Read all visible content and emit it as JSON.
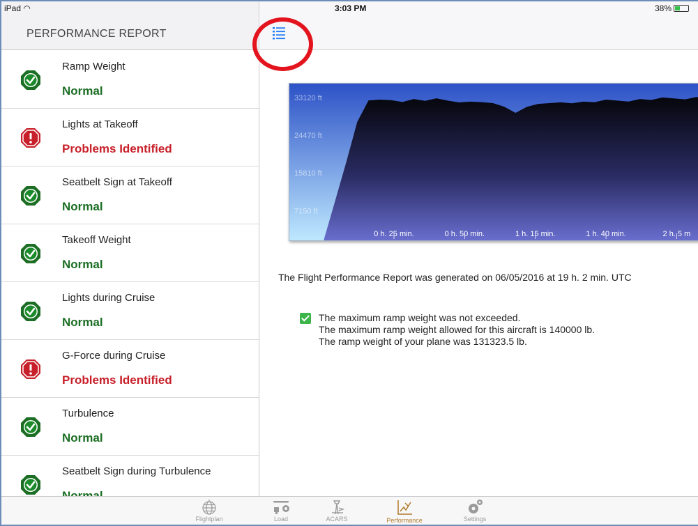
{
  "status_bar": {
    "carrier": "iPad",
    "time": "3:03 PM",
    "battery": "38%"
  },
  "sidebar": {
    "title": "PERFORMANCE REPORT",
    "items": [
      {
        "label": "Ramp Weight",
        "status": "Normal",
        "state": "ok"
      },
      {
        "label": "Lights at Takeoff",
        "status": "Problems Identified",
        "state": "bad"
      },
      {
        "label": "Seatbelt Sign at Takeoff",
        "status": "Normal",
        "state": "ok"
      },
      {
        "label": "Takeoff Weight",
        "status": "Normal",
        "state": "ok"
      },
      {
        "label": "Lights during Cruise",
        "status": "Normal",
        "state": "ok"
      },
      {
        "label": "G-Force during Cruise",
        "status": "Problems Identified",
        "state": "bad"
      },
      {
        "label": "Turbulence",
        "status": "Normal",
        "state": "ok"
      },
      {
        "label": "Seatbelt Sign during Turbulence",
        "status": "Normal",
        "state": "ok"
      }
    ]
  },
  "main": {
    "generated_text": "The Flight Performance Report was generated on 06/05/2016 at 19 h. 2 min. UTC",
    "weight_lines": [
      "The maximum ramp weight was not exceeded.",
      "The maximum ramp weight allowed for this aircraft is 140000 lb.",
      "The ramp weight of your plane was 131323.5 lb."
    ]
  },
  "chart_data": {
    "type": "area",
    "y_tick_labels": [
      "33120 ft",
      "24470 ft",
      "15810 ft",
      "7150 ft"
    ],
    "y_ticks": [
      33120,
      24470,
      15810,
      7150
    ],
    "x_tick_labels": [
      "0 h. 25 min.",
      "0 h. 50 min.",
      "1 h. 15 min.",
      "1 h. 40 min.",
      "2 h. 5 m"
    ],
    "x_ticks": [
      25,
      50,
      75,
      100,
      125
    ],
    "x": [
      0,
      4,
      8,
      12,
      16,
      20,
      24,
      28,
      32,
      36,
      40,
      44,
      48,
      52,
      56,
      60,
      64,
      68,
      72,
      76,
      80,
      84,
      88,
      92,
      96,
      100,
      104,
      108,
      112,
      116,
      120,
      124,
      128,
      132,
      136
    ],
    "altitude_ft": [
      0,
      9000,
      18000,
      27500,
      32600,
      32300,
      32500,
      32400,
      32600,
      32500,
      32600,
      32400,
      32300,
      32000,
      32200,
      31500,
      31000,
      29900,
      30800,
      31800,
      31500,
      32000,
      32100,
      32000,
      32200,
      32300,
      32400,
      32500,
      32600,
      32700,
      32800,
      32900,
      33000,
      33050,
      33100
    ],
    "xlim": [
      -12,
      136
    ],
    "ylim": [
      0,
      36300
    ],
    "colors": {
      "top": "#06060c",
      "bottom": "#6a6fd0",
      "sky_top": "#2d52c7",
      "sky_bottom": "#bfe9ff"
    }
  },
  "tabbar": {
    "tabs": [
      {
        "label": "Flightplan",
        "icon": "globe-icon"
      },
      {
        "label": "Load",
        "icon": "cargo-loader-icon"
      },
      {
        "label": "ACARS",
        "icon": "acars-tower-icon"
      },
      {
        "label": "Performance",
        "icon": "performance-chart-icon",
        "active": true
      },
      {
        "label": "Settings",
        "icon": "gear-icon"
      }
    ]
  }
}
